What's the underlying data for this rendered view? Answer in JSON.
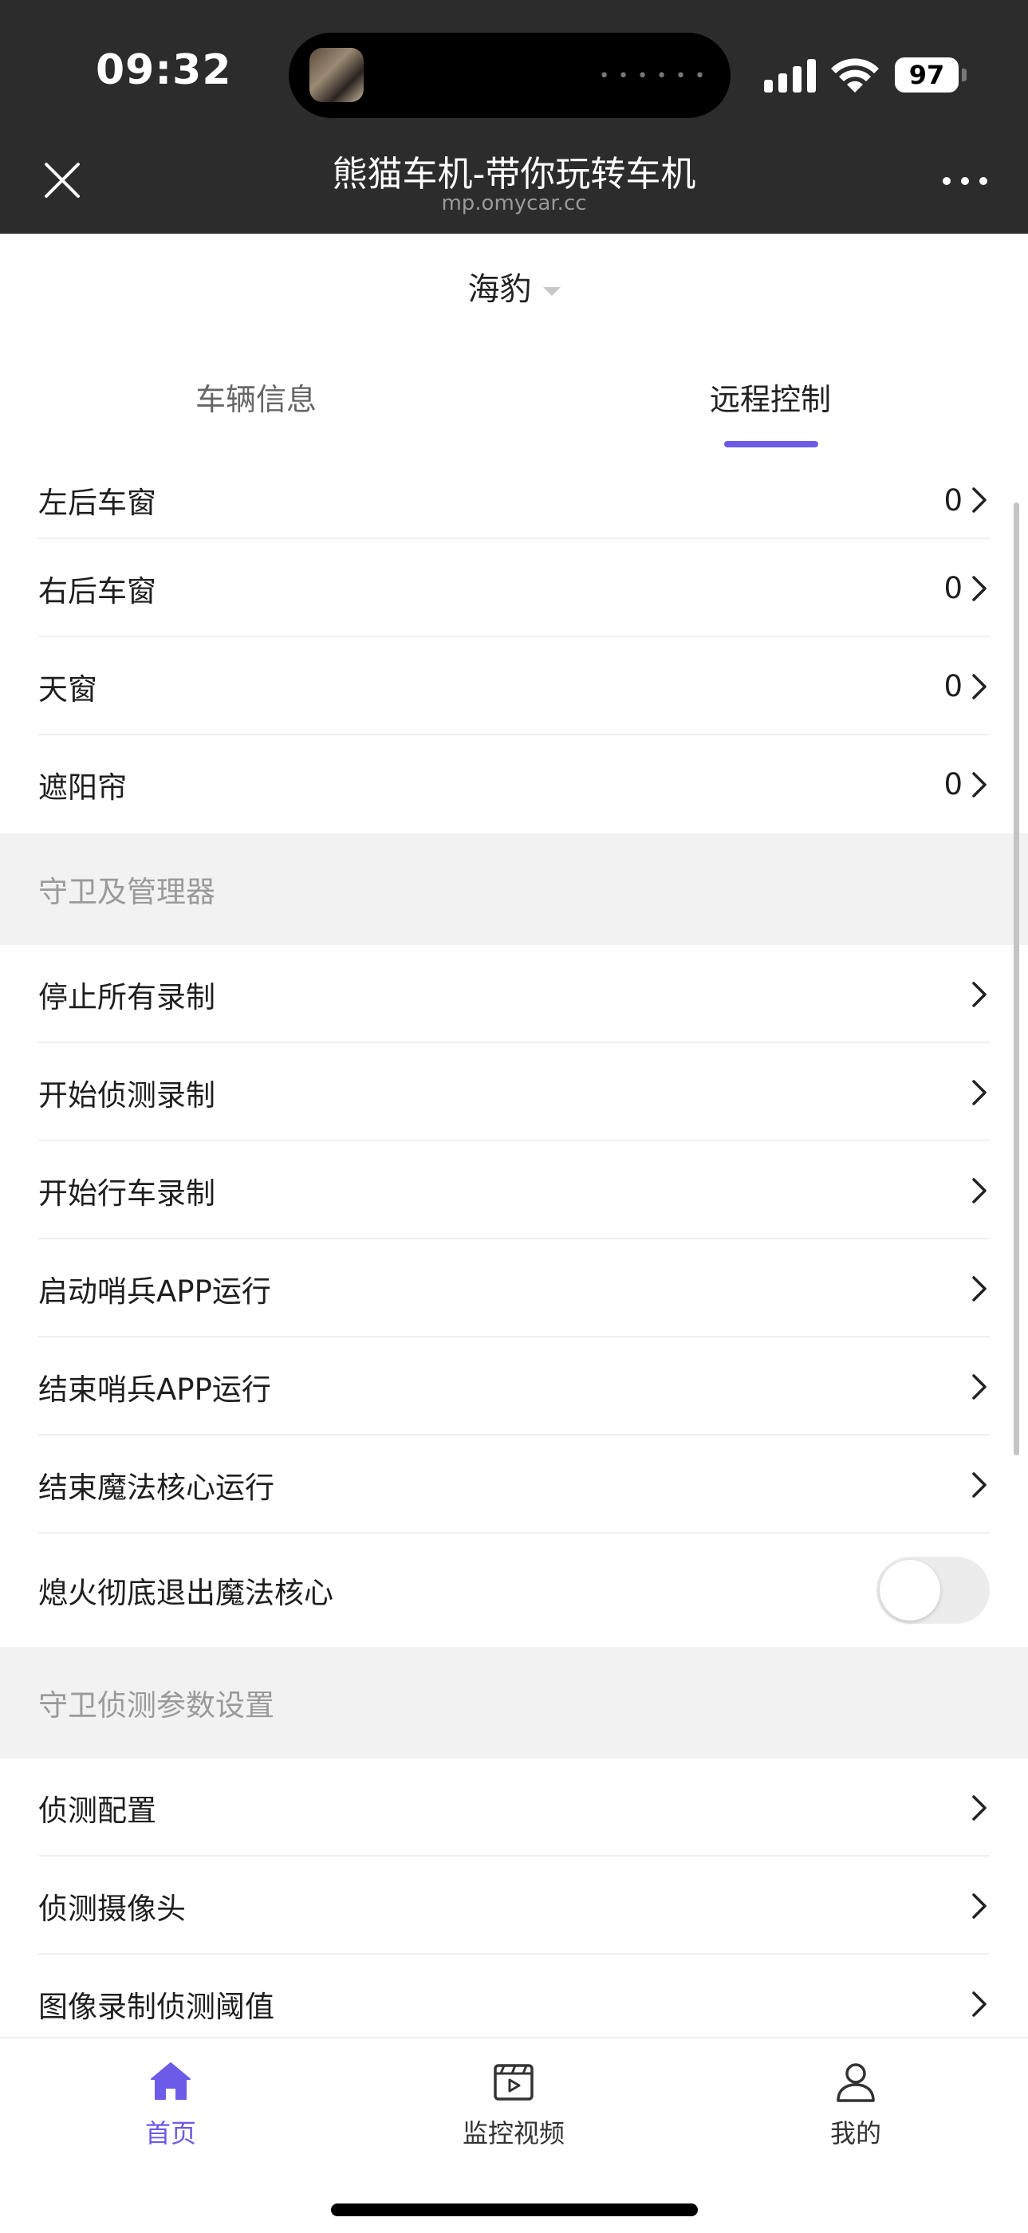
{
  "status_bar": {
    "time": "09:32",
    "battery": "97"
  },
  "nav": {
    "title": "熊猫车机-带你玩转车机",
    "subtitle": "mp.omycar.cc"
  },
  "vehicle": {
    "name": "海豹"
  },
  "tabs": [
    {
      "label": "车辆信息",
      "active": false
    },
    {
      "label": "远程控制",
      "active": true
    }
  ],
  "window_rows": [
    {
      "label": "左后车窗",
      "value": "0"
    },
    {
      "label": "右后车窗",
      "value": "0"
    },
    {
      "label": "天窗",
      "value": "0"
    },
    {
      "label": "遮阳帘",
      "value": "0"
    }
  ],
  "sections": {
    "guard": {
      "title": "守卫及管理器",
      "items": [
        {
          "label": "停止所有录制"
        },
        {
          "label": "开始侦测录制"
        },
        {
          "label": "开始行车录制"
        },
        {
          "label": "启动哨兵APP运行"
        },
        {
          "label": "结束哨兵APP运行"
        },
        {
          "label": "结束魔法核心运行"
        }
      ],
      "toggle": {
        "label": "熄火彻底退出魔法核心",
        "on": false
      }
    },
    "detect": {
      "title": "守卫侦测参数设置",
      "items": [
        {
          "label": "侦测配置"
        },
        {
          "label": "侦测摄像头"
        },
        {
          "label": "图像录制侦测阈值"
        }
      ]
    }
  },
  "tabbar": [
    {
      "label": "首页",
      "icon": "home-icon",
      "active": true
    },
    {
      "label": "监控视频",
      "icon": "video-icon",
      "active": false
    },
    {
      "label": "我的",
      "icon": "user-icon",
      "active": false
    }
  ],
  "colors": {
    "accent": "#6b5be6",
    "topbar": "#2c2c2c",
    "section_bg": "#f2f2f2"
  }
}
